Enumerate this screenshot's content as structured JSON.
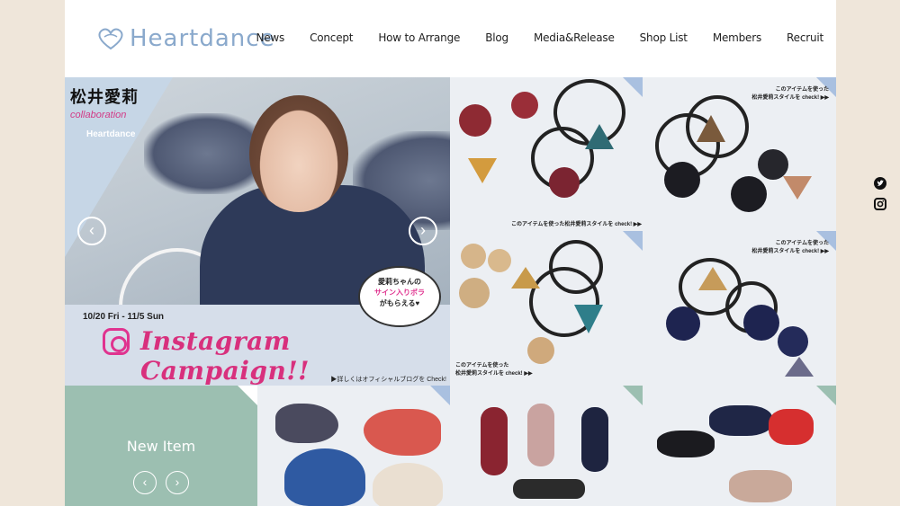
{
  "header": {
    "logo_text": "Heartdance",
    "nav": [
      "News",
      "Concept",
      "How to Arrange",
      "Blog",
      "Media&Release",
      "Shop List",
      "Members",
      "Recruit"
    ]
  },
  "hero": {
    "title": "松井愛莉",
    "subtitle": "collaboration",
    "brand": "Heartdance",
    "bubble_line1": "愛莉ちゃんの",
    "bubble_line2": "サイン入りポラ",
    "bubble_line3": "がもらえる♥",
    "date": "10/20 Fri - 11/5 Sun",
    "campaign": "Instagram Campaign!!",
    "detail": "▶詳しくはオフィシャルブログを Check!",
    "prev_glyph": "‹",
    "next_glyph": "›"
  },
  "tiles": {
    "caption_a": "このアイテムを使った松井愛莉スタイルを check! ▶▶",
    "caption_b_line1": "このアイテムを使った",
    "caption_b_line2": "松井愛莉スタイルを check! ▶▶"
  },
  "new_item": {
    "label": "New Item",
    "prev_glyph": "‹",
    "next_glyph": "›"
  },
  "social": {
    "twitter_icon": "twitter-icon",
    "instagram_icon": "instagram-icon"
  },
  "colors": {
    "logo": "#8aa9cc",
    "campaign_pink": "#d8307d",
    "new_item_bg": "#9cbfb1"
  }
}
